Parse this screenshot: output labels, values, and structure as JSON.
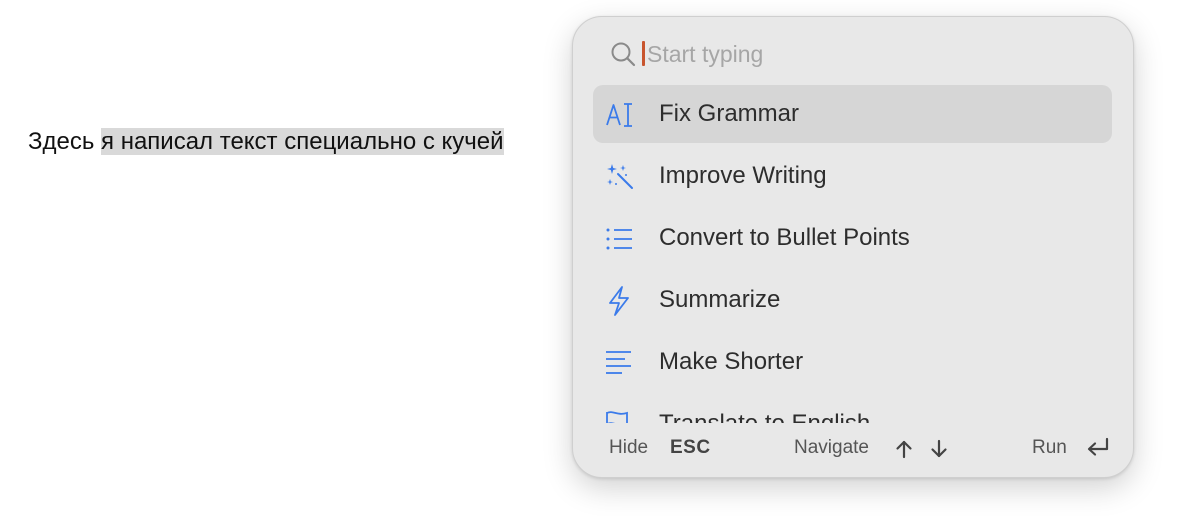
{
  "document": {
    "text_plain": "Здесь ",
    "text_selected": "я написал текст специально с кучей"
  },
  "palette": {
    "accent": "#3b7bea",
    "caret": "#c8552e",
    "selection": "#d9d9d9",
    "popup_bg": "#e8e8e8",
    "item_selected_bg": "#d6d6d6"
  },
  "popup": {
    "search": {
      "placeholder": "Start typing",
      "value": "",
      "icon": "search-icon"
    },
    "items": [
      {
        "label": "Fix Grammar",
        "icon": "text-cursor-icon",
        "selected": true
      },
      {
        "label": "Improve Writing",
        "icon": "magic-wand-icon",
        "selected": false
      },
      {
        "label": "Convert to Bullet Points",
        "icon": "bullet-list-icon",
        "selected": false
      },
      {
        "label": "Summarize",
        "icon": "lightning-icon",
        "selected": false
      },
      {
        "label": "Make Shorter",
        "icon": "align-left-icon",
        "selected": false
      },
      {
        "label": "Translate to English",
        "icon": "flag-icon",
        "selected": false
      }
    ],
    "footer": {
      "hide_label": "Hide",
      "hide_key": "ESC",
      "navigate_label": "Navigate",
      "run_label": "Run"
    }
  }
}
